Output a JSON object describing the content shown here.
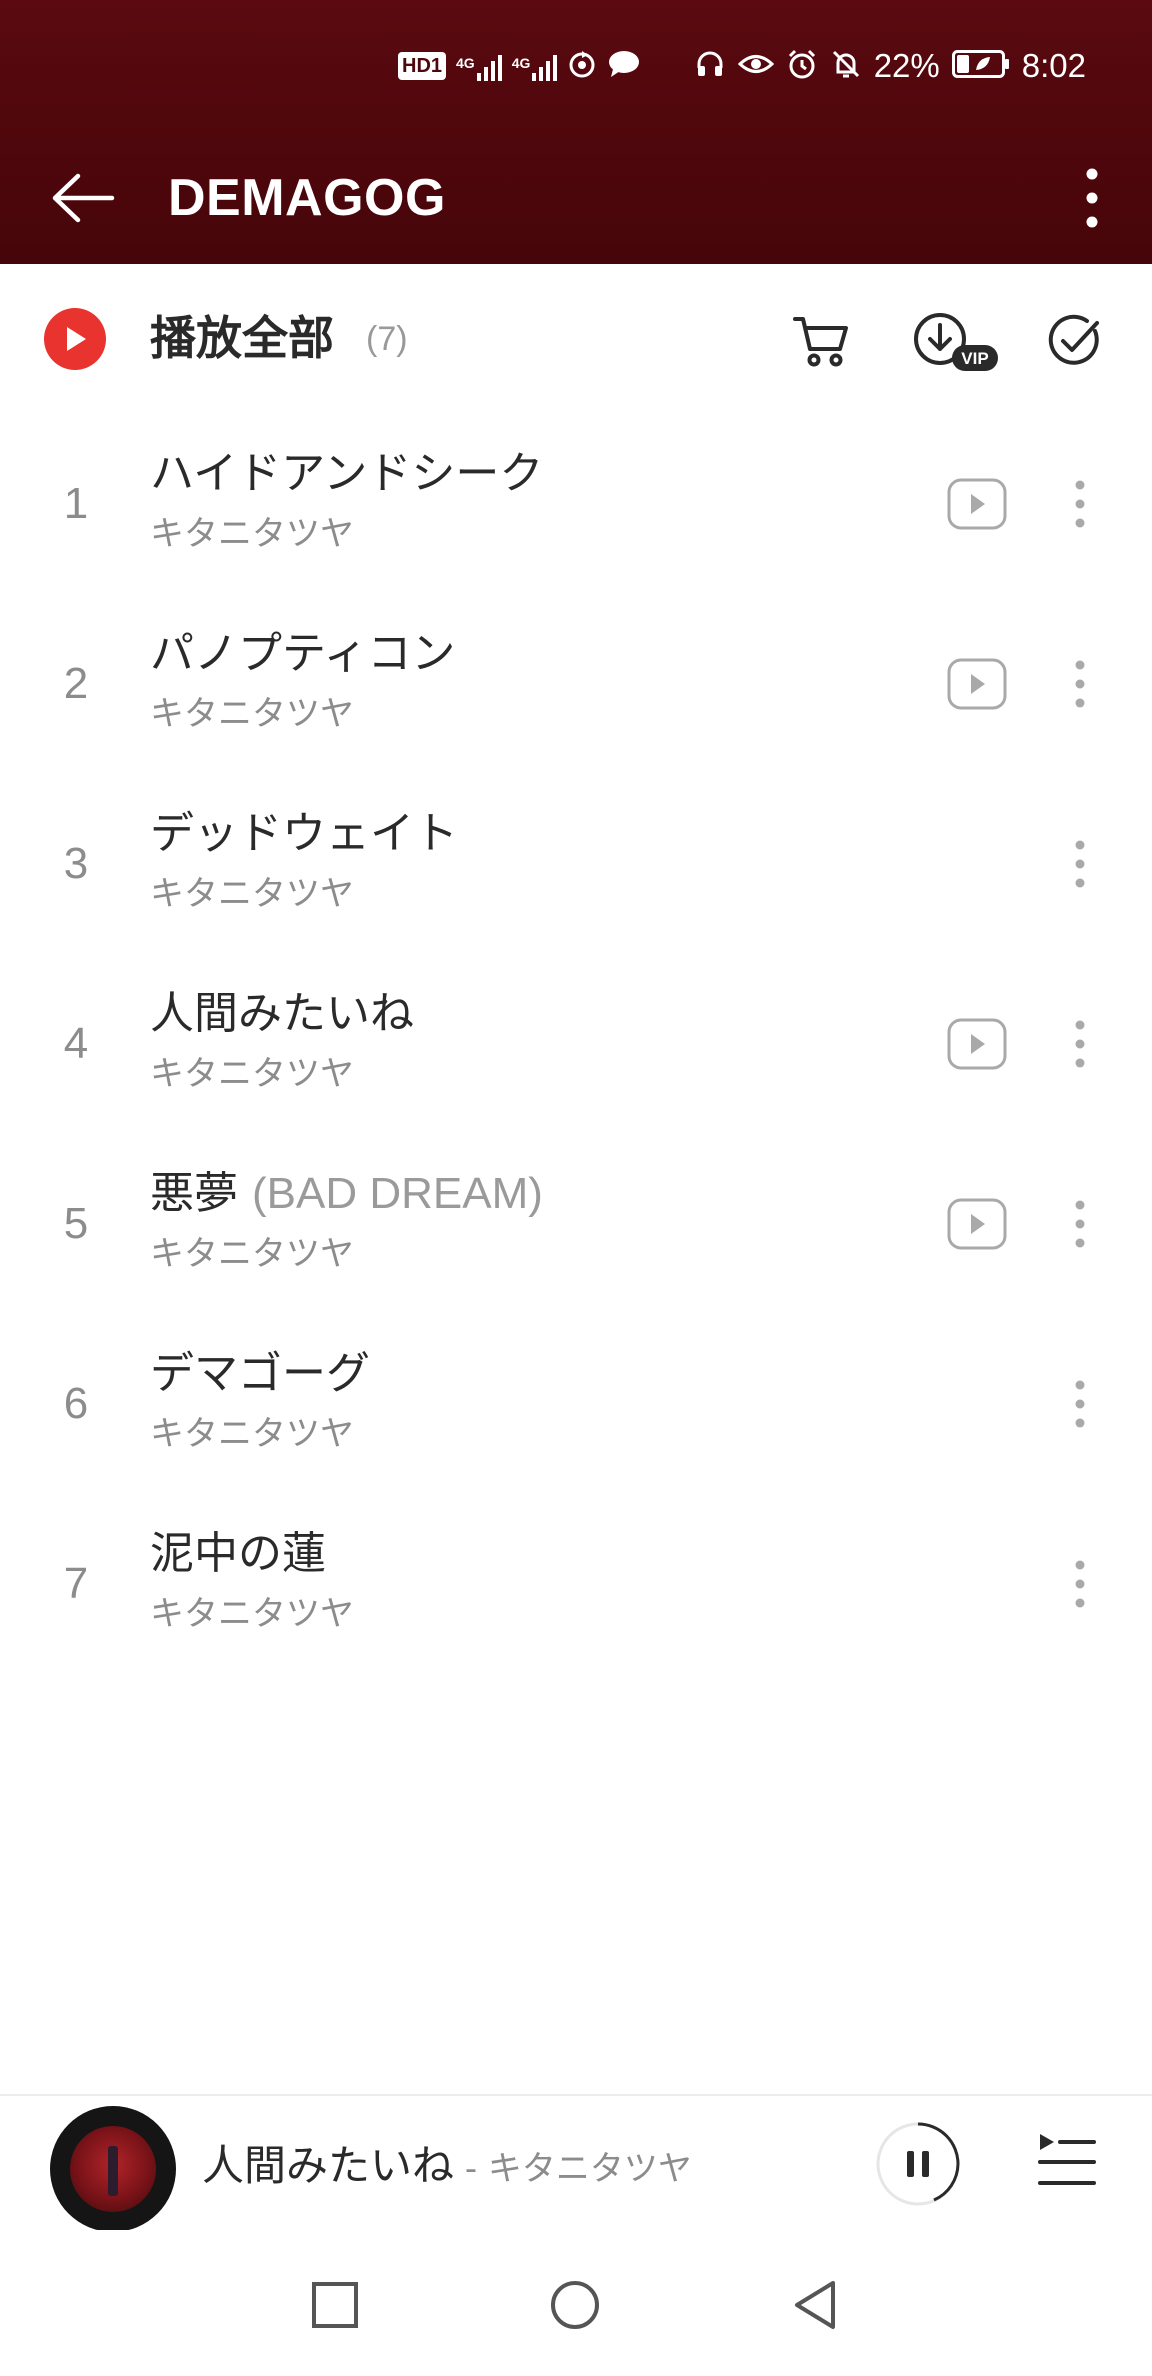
{
  "status_bar": {
    "hd_label": "HD",
    "hd_sub": "1",
    "net1": "4G",
    "net2": "4G",
    "battery_percent": "22%",
    "time": "8:02",
    "icons": [
      "hd-icon",
      "signal-icon",
      "signal-icon",
      "sync-icon",
      "chat-icon",
      "headset-icon",
      "eye-icon",
      "alarm-icon",
      "mute-bell-icon",
      "battery-icon"
    ]
  },
  "app_bar": {
    "title": "DEMAGOG",
    "back_icon": "arrow-left-icon",
    "more_icon": "more-vertical-icon"
  },
  "play_all": {
    "label": "播放全部",
    "count": "(7)",
    "actions": [
      "cart-icon",
      "download-vip-icon",
      "multi-select-icon"
    ]
  },
  "tracks": [
    {
      "number": "1",
      "title": "ハイドアンドシーク",
      "subtitle": "",
      "artist": "キタニタツヤ",
      "has_mv": true
    },
    {
      "number": "2",
      "title": "パノプティコン",
      "subtitle": "",
      "artist": "キタニタツヤ",
      "has_mv": true
    },
    {
      "number": "3",
      "title": "デッドウェイト",
      "subtitle": "",
      "artist": "キタニタツヤ",
      "has_mv": false
    },
    {
      "number": "4",
      "title": "人間みたいね",
      "subtitle": "",
      "artist": "キタニタツヤ",
      "has_mv": true
    },
    {
      "number": "5",
      "title": "悪夢",
      "subtitle": "(BAD DREAM)",
      "artist": "キタニタツヤ",
      "has_mv": true
    },
    {
      "number": "6",
      "title": "デマゴーグ",
      "subtitle": "",
      "artist": "キタニタツヤ",
      "has_mv": false
    },
    {
      "number": "7",
      "title": "泥中の蓮",
      "subtitle": "",
      "artist": "キタニタツヤ",
      "has_mv": false
    }
  ],
  "mini_player": {
    "title": "人間みたいね",
    "separator": " - ",
    "artist": "キタニタツヤ",
    "state": "playing"
  },
  "colors": {
    "header": "#4e070c",
    "accent_red": "#e8332f",
    "text_primary": "#2a2a2a",
    "text_secondary": "#8c8c8c"
  }
}
